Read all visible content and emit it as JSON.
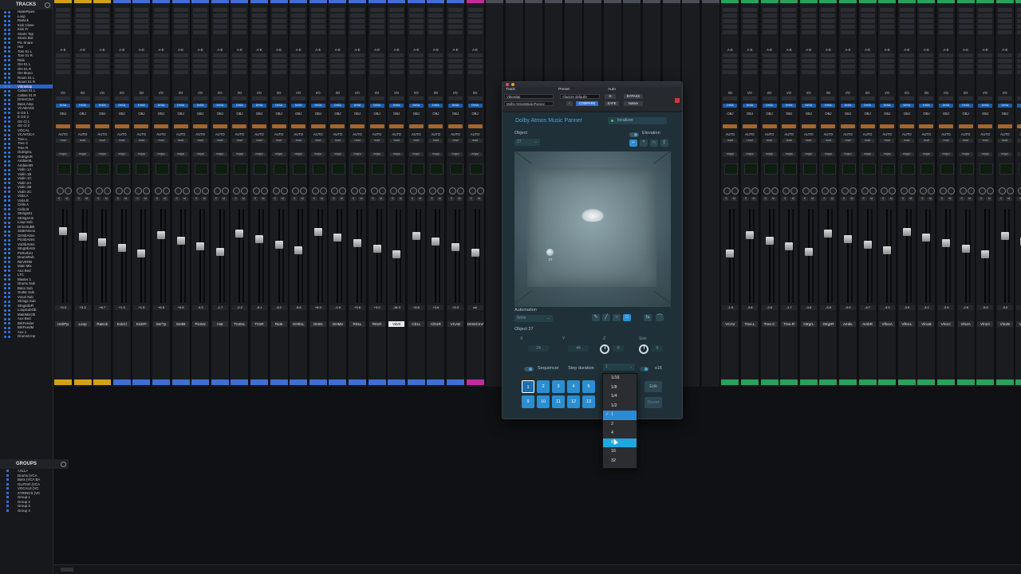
{
  "left_panel": {
    "tracks_title": "TRACKS",
    "tracks": [
      "HateIPipes",
      "Loop",
      "RaKick",
      "Kick Close",
      "Kick Fr",
      "Snare Top",
      "Snare Bot",
      "Pic Snare",
      "Hat",
      "Tom 01 L",
      "Tom 01 R",
      "Ride",
      "OH 01 L",
      "OH 01 R",
      "OH Mono",
      "Room 01 L",
      "Room 01 R",
      "Vibraslap",
      "Cabas 01 L",
      "Cabas 01 R",
      "DrmsCmA",
      "Bass Amp",
      "VCABASS",
      "E Gtr 1",
      "E Gtr 2",
      "Gtr Cl 1",
      "Gtr Cl 2",
      "VOCAL",
      "VCAVOCA",
      "Tree L",
      "Tree C",
      "Tree R",
      "OutrigrsL",
      "OutrigrsR",
      "AmbientL",
      "AmbientR",
      "Violin 1A",
      "Violin 1B",
      "Violin 1C",
      "Violin 2A",
      "Violin 2B",
      "Violin 2C",
      "Viola A",
      "Viola B",
      "Cello A",
      "Cello B",
      "Strings01",
      "StringsAm",
      "Loop Sub",
      "DrmsSubB",
      "SnBtAtmos",
      "GtrSbAtms",
      "PicSbAtms",
      "VoiSbAtms",
      "StngSbAtm",
      "PnRvrbAt",
      "DrumsRvb",
      "REVERB",
      "Main Mix",
      "Aux Bed",
      "LTC",
      "Master 1",
      "Drums Sub",
      "Bass Sub",
      "Guitar Sub",
      "Vocal Sub",
      "Strings Sub",
      "StngsSbFl",
      "LoopSubOb",
      "MainMixOb",
      "Aux Bed",
      "BrkFeeder",
      "BrkFeedM",
      "Aux 1",
      "DrumsCmp"
    ],
    "selected_track_index": 17,
    "groups_title": "GROUPS",
    "groups": [
      "<ALL>",
      "Drums (VCA",
      "Bass (VCA BA",
      "GUITAR (VCA",
      "VOCALS (VC",
      "STRINGS (VC",
      "Group 1",
      "Group 2",
      "Group 3",
      "Group 4"
    ]
  },
  "mixer": {
    "strip_names": [
      "HshPp",
      "Loop",
      "RaKck",
      "KckCl",
      "KickFr",
      "SnrTp",
      "SnrBt",
      "PicSnr",
      "Hat",
      "Tm01L",
      "T01R",
      "Ride",
      "OH01L",
      "OH01",
      "OHMn",
      "R01L",
      "R01R",
      "Vibrtl",
      "Cb1L",
      "Cl01R",
      "VCAD",
      "DrmsCmA",
      "",
      "",
      "",
      "",
      "",
      "",
      "",
      "",
      "",
      "",
      "",
      "",
      "VCAV",
      "Tree.L",
      "Tree.C",
      "Tree.R",
      "OtrgrL",
      "OtrgrR",
      "AmbL",
      "AmbR",
      "Vlln1A",
      "Vlln1L",
      "Vln1B",
      "Vln1C",
      "Vln2A",
      "Vln2A",
      "Vln2B",
      "ViolaA",
      "Vio"
    ],
    "volumes": [
      "+3.3",
      "+3.3",
      "+6.7",
      "+1.3",
      "+1.5",
      "+6.5",
      "+6.5",
      "-4.3",
      "-1.7",
      "-2.2",
      "-6.1",
      "-6.1",
      "-5.6",
      "+6.9",
      "-1.9",
      "+3.6",
      "+3.0",
      "-16.3",
      "+3.8",
      "+3.6",
      "+3.3",
      "vol",
      "",
      "",
      "",
      "",
      "",
      "",
      "",
      "",
      "",
      "",
      "",
      "",
      "-1.9",
      "-3.8",
      "-2.6",
      "-1.7",
      "-4.6",
      "-3.8",
      "-0.9",
      "-4.7",
      "-4.1",
      "-3.9",
      "-3.1",
      "-2.5",
      "-2.6",
      "-5.9",
      "-3.0",
      "+0.4",
      "-3.3"
    ],
    "selected_strip_index": 17,
    "rows": {
      "insert": "I/O",
      "send": "A-E",
      "auto": "AUTO",
      "read": "read",
      "nogrp": "nogrp",
      "solo": "S",
      "mute": "M",
      "output": "DrSA",
      "obj": "OBJ"
    }
  },
  "plugin": {
    "header": {
      "track_label": "Track",
      "preset_label": "Preset",
      "auto_label": "Auto",
      "track_value": "Vibraslap",
      "preset_value": "<factory default>",
      "plugin_value": "Dolby AtmosMusicPanner",
      "bypass": "BYPASS",
      "compare": "COMPARE",
      "safe": "SAFE",
      "native": "Native"
    },
    "brand": "Dolby Atmos Music Panner",
    "localizer": "localizer",
    "object_label": "Object",
    "object_value": "27",
    "elevation_label": "Elevation",
    "object_dot_label": "27",
    "automation_label": "Automation",
    "automation_mode": "Write",
    "object_title": "Object 27",
    "axes": {
      "x": "X",
      "y": "Y",
      "z": "Z",
      "size": "Size"
    },
    "axis_values": {
      "x": "24",
      "y": "44",
      "z": "0",
      "size": "0"
    },
    "sequencer_label": "Sequencer",
    "step_duration_label": "Step duration",
    "step_duration_value": "1",
    "x16_label": "x16",
    "steps_row1": [
      "1",
      "2",
      "3",
      "4",
      "5"
    ],
    "steps_row2": [
      "9",
      "10",
      "11",
      "12",
      "13"
    ],
    "edit_label": "Edit",
    "reset_label": "Reset"
  },
  "dropdown": {
    "options": [
      "1/16",
      "1/8",
      "1/4",
      "1/2",
      "1",
      "2",
      "4",
      "8",
      "16",
      "32"
    ],
    "checked": "1",
    "hovered": "8"
  },
  "colors": {
    "accent": "#2a8ed1",
    "selection": "#2c63c9",
    "panel": "#1f3038"
  }
}
